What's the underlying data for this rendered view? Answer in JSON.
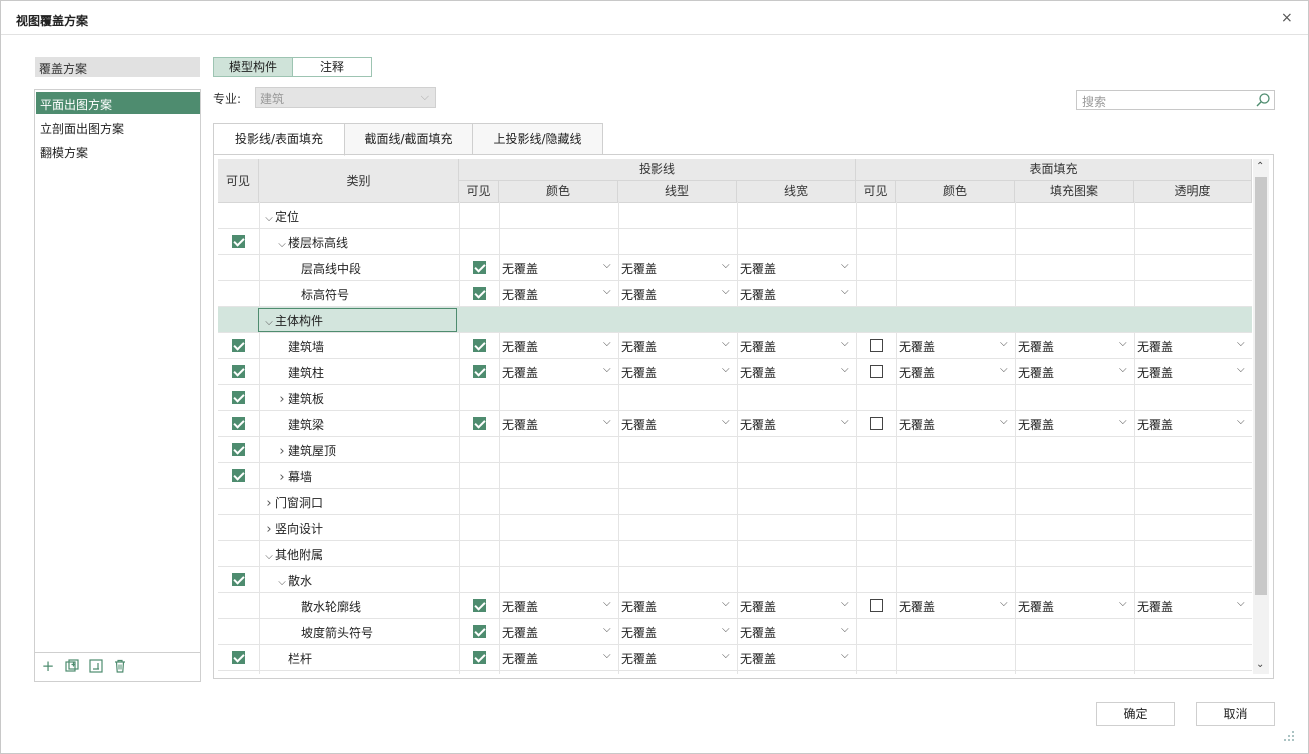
{
  "window": {
    "title": "视图覆盖方案",
    "close_glyph": "×"
  },
  "left": {
    "header": "覆盖方案",
    "items": [
      {
        "label": "平面出图方案",
        "selected": true
      },
      {
        "label": "立剖面出图方案",
        "selected": false
      },
      {
        "label": "翻模方案",
        "selected": false
      }
    ],
    "footer_icons": [
      "add-icon",
      "duplicate-icon",
      "rename-icon",
      "delete-icon"
    ]
  },
  "mode": {
    "model_label": "模型构件",
    "annot_label": "注释",
    "active": "模型构件"
  },
  "filter": {
    "spec_label": "专业:",
    "spec_value": "建筑",
    "search_placeholder": "搜索"
  },
  "tabs": [
    {
      "label": "投影线/表面填充",
      "active": true
    },
    {
      "label": "截面线/截面填充",
      "active": false
    },
    {
      "label": "上投影线/隐藏线",
      "active": false
    }
  ],
  "grid": {
    "headers": {
      "visible": "可见",
      "category": "类别",
      "projection": "投影线",
      "surface": "表面填充",
      "sub_visible": "可见",
      "color": "颜色",
      "linetype": "线型",
      "linewidth": "线宽",
      "surf_visible": "可见",
      "surf_color": "颜色",
      "pattern": "填充图案",
      "transparency": "透明度"
    },
    "override_text": "无覆盖",
    "rows": [
      {
        "name": "定位",
        "level": 0,
        "expander": "expanded",
        "vis": null,
        "proj": null,
        "surf": null
      },
      {
        "name": "楼层标高线",
        "level": 1,
        "expander": "expanded",
        "vis": true,
        "proj": null,
        "surf": null
      },
      {
        "name": "层高线中段",
        "level": 2,
        "expander": "none",
        "vis": null,
        "proj": true,
        "surf": null
      },
      {
        "name": "标高符号",
        "level": 2,
        "expander": "none",
        "vis": null,
        "proj": true,
        "surf": null
      },
      {
        "name": "主体构件",
        "level": 0,
        "expander": "expanded",
        "vis": null,
        "proj": null,
        "surf": null,
        "highlighted": true
      },
      {
        "name": "建筑墙",
        "level": 1,
        "expander": "none",
        "vis": true,
        "proj": true,
        "surf": false
      },
      {
        "name": "建筑柱",
        "level": 1,
        "expander": "none",
        "vis": true,
        "proj": true,
        "surf": false
      },
      {
        "name": "建筑板",
        "level": 1,
        "expander": "collapsed",
        "vis": true,
        "proj": null,
        "surf": null
      },
      {
        "name": "建筑梁",
        "level": 1,
        "expander": "none",
        "vis": true,
        "proj": true,
        "surf": false
      },
      {
        "name": "建筑屋顶",
        "level": 1,
        "expander": "collapsed",
        "vis": true,
        "proj": null,
        "surf": null
      },
      {
        "name": "幕墙",
        "level": 1,
        "expander": "collapsed",
        "vis": true,
        "proj": null,
        "surf": null
      },
      {
        "name": "门窗洞口",
        "level": 0,
        "expander": "collapsed",
        "vis": null,
        "proj": null,
        "surf": null
      },
      {
        "name": "竖向设计",
        "level": 0,
        "expander": "collapsed",
        "vis": null,
        "proj": null,
        "surf": null
      },
      {
        "name": "其他附属",
        "level": 0,
        "expander": "expanded",
        "vis": null,
        "proj": null,
        "surf": null
      },
      {
        "name": "散水",
        "level": 1,
        "expander": "expanded",
        "vis": true,
        "proj": null,
        "surf": null
      },
      {
        "name": "散水轮廓线",
        "level": 2,
        "expander": "none",
        "vis": null,
        "proj": true,
        "surf": false
      },
      {
        "name": "坡度箭头符号",
        "level": 2,
        "expander": "none",
        "vis": null,
        "proj": true,
        "surf": null
      },
      {
        "name": "栏杆",
        "level": 1,
        "expander": "none",
        "vis": true,
        "proj": true,
        "surf": null
      }
    ]
  },
  "buttons": {
    "ok": "确定",
    "cancel": "取消"
  },
  "colors": {
    "accent": "#4e8c6f",
    "highlight_row": "#d3e5dd",
    "header_bg": "#e9e9e9"
  }
}
